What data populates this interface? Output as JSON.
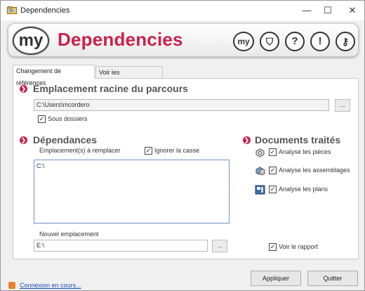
{
  "window": {
    "title": "Dependencies",
    "min_glyph": "—",
    "max_glyph": "☐",
    "close_glyph": "✕"
  },
  "banner": {
    "logo_text": "my",
    "title": "Dependencies",
    "icons": [
      {
        "name": "my-circle-icon",
        "glyph": "my"
      },
      {
        "name": "shield-icon",
        "glyph": "⛉"
      },
      {
        "name": "help-icon",
        "glyph": "?"
      },
      {
        "name": "alert-icon",
        "glyph": "!"
      },
      {
        "name": "key-icon",
        "glyph": "⚷"
      }
    ],
    "accent_color": "#c8224c"
  },
  "tabs": [
    {
      "label": "Changement de références",
      "active": true
    },
    {
      "label": "Voir les dépendances",
      "active": false
    }
  ],
  "root_section": {
    "title": "Emplacement racine du parcours",
    "path_value": "C:\\Users\\mcordero",
    "browse_label": "...",
    "subfolders_label": "Sous dossiers",
    "subfolders_checked": true
  },
  "dependencies_section": {
    "title": "Dépendances",
    "replace_label": "Emplacement(s) à remplacer",
    "ignore_case_label": "Ignorer la casse",
    "ignore_case_checked": true,
    "replace_value": "C:\\",
    "new_location_label": "Nouvel emplacement",
    "new_location_value": "E:\\",
    "browse_label": "..."
  },
  "documents_section": {
    "title": "Documents traités",
    "items": [
      {
        "label": "Analyse les pièces",
        "checked": true,
        "icon": "part-icon"
      },
      {
        "label": "Analyse les assemblages",
        "checked": true,
        "icon": "assembly-icon"
      },
      {
        "label": "Analyse les plans",
        "checked": true,
        "icon": "drawing-icon"
      }
    ],
    "report_label": "Voir le rapport",
    "report_checked": true
  },
  "footer": {
    "apply_label": "Appliquer",
    "quit_label": "Quitter",
    "status_text": "Connexion en cours..."
  },
  "check_glyph": "✓"
}
